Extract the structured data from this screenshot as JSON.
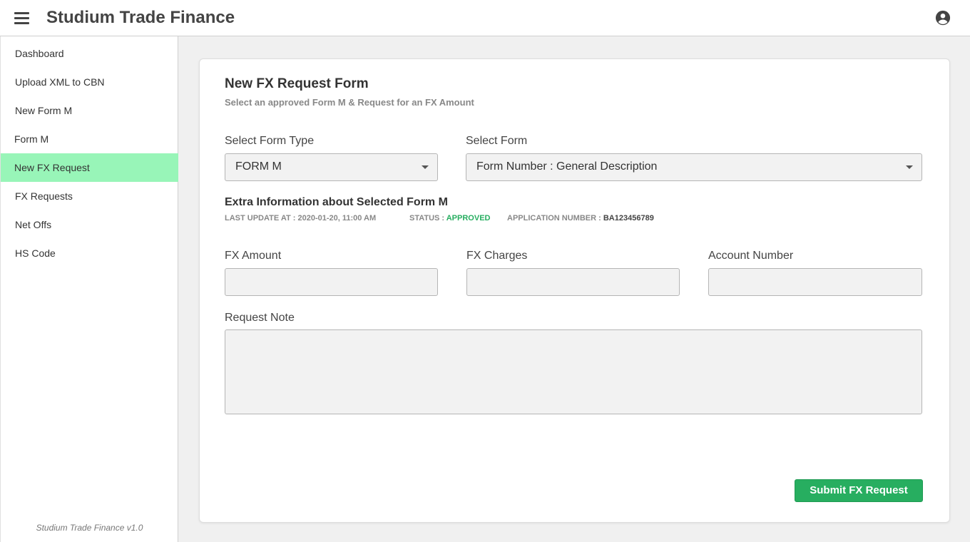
{
  "app": {
    "title": "Studium Trade Finance",
    "version": "Studium Trade Finance v1.0"
  },
  "sidebar": {
    "items": [
      {
        "label": "Dashboard"
      },
      {
        "label": "Upload XML to CBN"
      },
      {
        "label": "New Form M"
      },
      {
        "label": "Form M"
      },
      {
        "label": "New FX Request",
        "active": true
      },
      {
        "label": "FX Requests"
      },
      {
        "label": "Net Offs"
      },
      {
        "label": "HS Code"
      }
    ]
  },
  "form": {
    "title": "New FX Request Form",
    "subtitle": "Select an approved Form M & Request for an FX Amount",
    "form_type": {
      "label": "Select Form Type",
      "value": "FORM M"
    },
    "select_form": {
      "label": "Select Form",
      "value": "Form Number : General Description"
    },
    "extra": {
      "title": "Extra Information about Selected Form M",
      "last_update_label": "LAST UPDATE AT : ",
      "last_update_value": "2020-01-20, 11:00 AM",
      "status_label": "STATUS : ",
      "status_value": "APPROVED",
      "application_label": "APPLICATION NUMBER : ",
      "application_value": "BA123456789"
    },
    "fx_amount": {
      "label": "FX Amount",
      "value": ""
    },
    "fx_charges": {
      "label": "FX Charges",
      "value": ""
    },
    "account_number": {
      "label": "Account Number",
      "value": ""
    },
    "request_note": {
      "label": "Request Note",
      "value": ""
    },
    "submit_label": "Submit FX Request"
  },
  "colors": {
    "accent": "#27ae60",
    "active_nav": "#98f5b8",
    "status_approved": "#27ae60"
  }
}
